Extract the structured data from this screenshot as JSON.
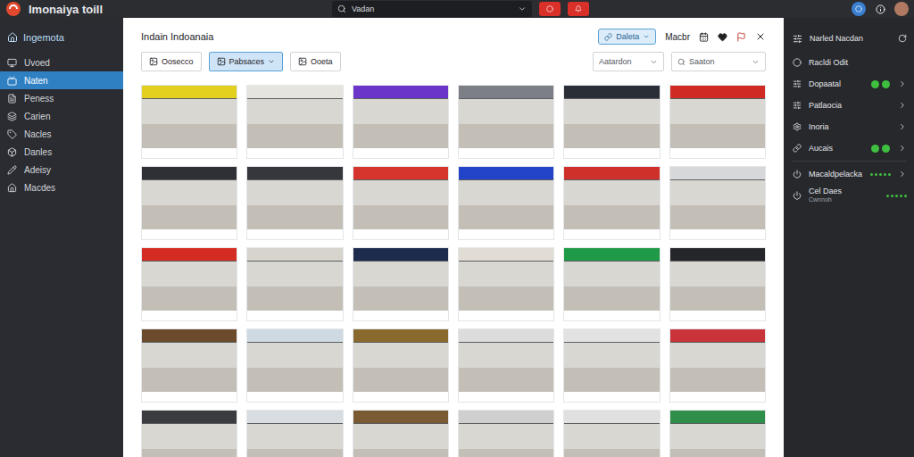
{
  "app": {
    "title": "Imonaiya toill"
  },
  "search": {
    "value": "Vadan"
  },
  "sidebar": {
    "header": "Ingemota",
    "items": [
      {
        "label": "Uvoed",
        "selected": false
      },
      {
        "label": "Naten",
        "selected": true
      },
      {
        "label": "Peness",
        "selected": false
      },
      {
        "label": "Carien",
        "selected": false
      },
      {
        "label": "Nacles",
        "selected": false
      },
      {
        "label": "Danles",
        "selected": false
      },
      {
        "label": "Adeisy",
        "selected": false
      },
      {
        "label": "Macdes",
        "selected": false
      }
    ]
  },
  "panel": {
    "title": "Indain Indoanaia",
    "action_button": "Daleta",
    "action_link": "Macbr",
    "filters": [
      {
        "label": "Oosecco",
        "selected": false
      },
      {
        "label": "Pabsaces",
        "selected": true
      },
      {
        "label": "Ooeta",
        "selected": false
      }
    ],
    "dropdown": "Aatardon",
    "search_placeholder": "Saaton"
  },
  "gallery": [
    {
      "color": "#e3d01e"
    },
    {
      "color": "#e6e4df"
    },
    {
      "color": "#6a35c8"
    },
    {
      "color": "#7d7f86"
    },
    {
      "color": "#2a2e36"
    },
    {
      "color": "#cf2a24"
    },
    {
      "color": "#2e3036"
    },
    {
      "color": "#35373c"
    },
    {
      "color": "#d6352d"
    },
    {
      "color": "#2344c8"
    },
    {
      "color": "#d0302a"
    },
    {
      "color": "#d6d8da"
    },
    {
      "color": "#d42b22"
    },
    {
      "color": "#d7d4ce"
    },
    {
      "color": "#1d2b4d"
    },
    {
      "color": "#e1ddd5"
    },
    {
      "color": "#1f9a46"
    },
    {
      "color": "#24262a"
    },
    {
      "color": "#6b4b2b"
    },
    {
      "color": "#cfd9e2"
    },
    {
      "color": "#8a6a2c"
    },
    {
      "color": "#dcdcdc"
    },
    {
      "color": "#e2e2e2"
    },
    {
      "color": "#c9343a"
    },
    {
      "color": "#3a3c40"
    },
    {
      "color": "#d8dde2"
    },
    {
      "color": "#7a5a32"
    },
    {
      "color": "#cfcfcf"
    },
    {
      "color": "#e0e0e0"
    },
    {
      "color": "#2f8f4a"
    }
  ],
  "settings": {
    "title": "Narled Nacdan",
    "items": [
      {
        "label": "Racldi Odit",
        "kind": "plain"
      },
      {
        "label": "Dopaatal",
        "kind": "toggle",
        "on": true
      },
      {
        "label": "Patlaocia",
        "kind": "link"
      },
      {
        "label": "Inoria",
        "kind": "link"
      },
      {
        "label": "Aucais",
        "kind": "toggle",
        "on": true
      },
      {
        "label": "Macaldpelacka",
        "kind": "dots"
      },
      {
        "label": "Cel Daes",
        "sublabel": "Cwnnoh",
        "kind": "meter"
      }
    ]
  }
}
